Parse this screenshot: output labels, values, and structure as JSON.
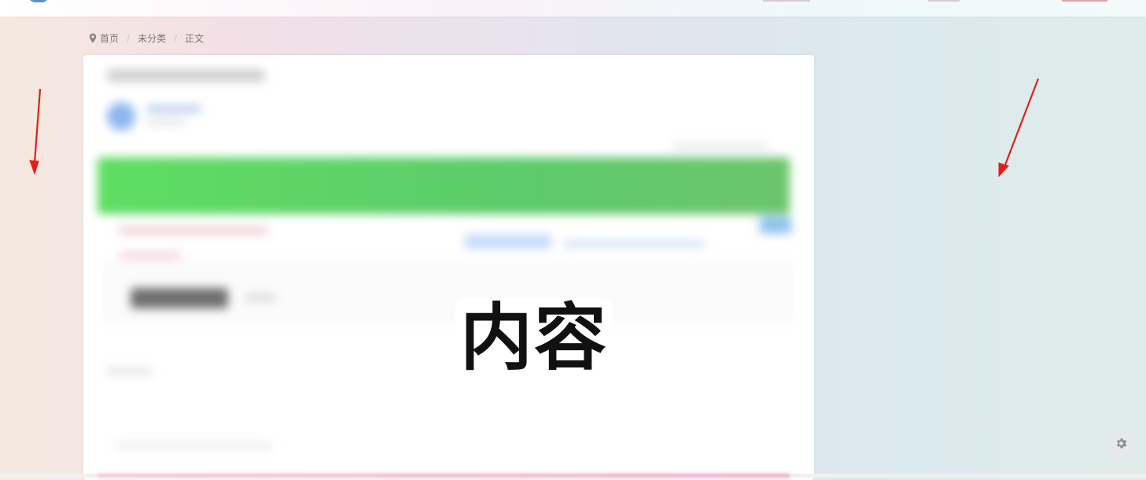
{
  "breadcrumb": {
    "icon": "location-pin-icon",
    "home": "首页",
    "category": "未分类",
    "current": "正文"
  },
  "overlay": {
    "label": "内容"
  },
  "settings": {
    "icon": "gear-icon"
  },
  "colors": {
    "accent_green": "#5fd36a",
    "accent_blue": "#6aa8f0",
    "arrow_red": "#e0201a",
    "gear_bg": "#e6e9ea"
  }
}
